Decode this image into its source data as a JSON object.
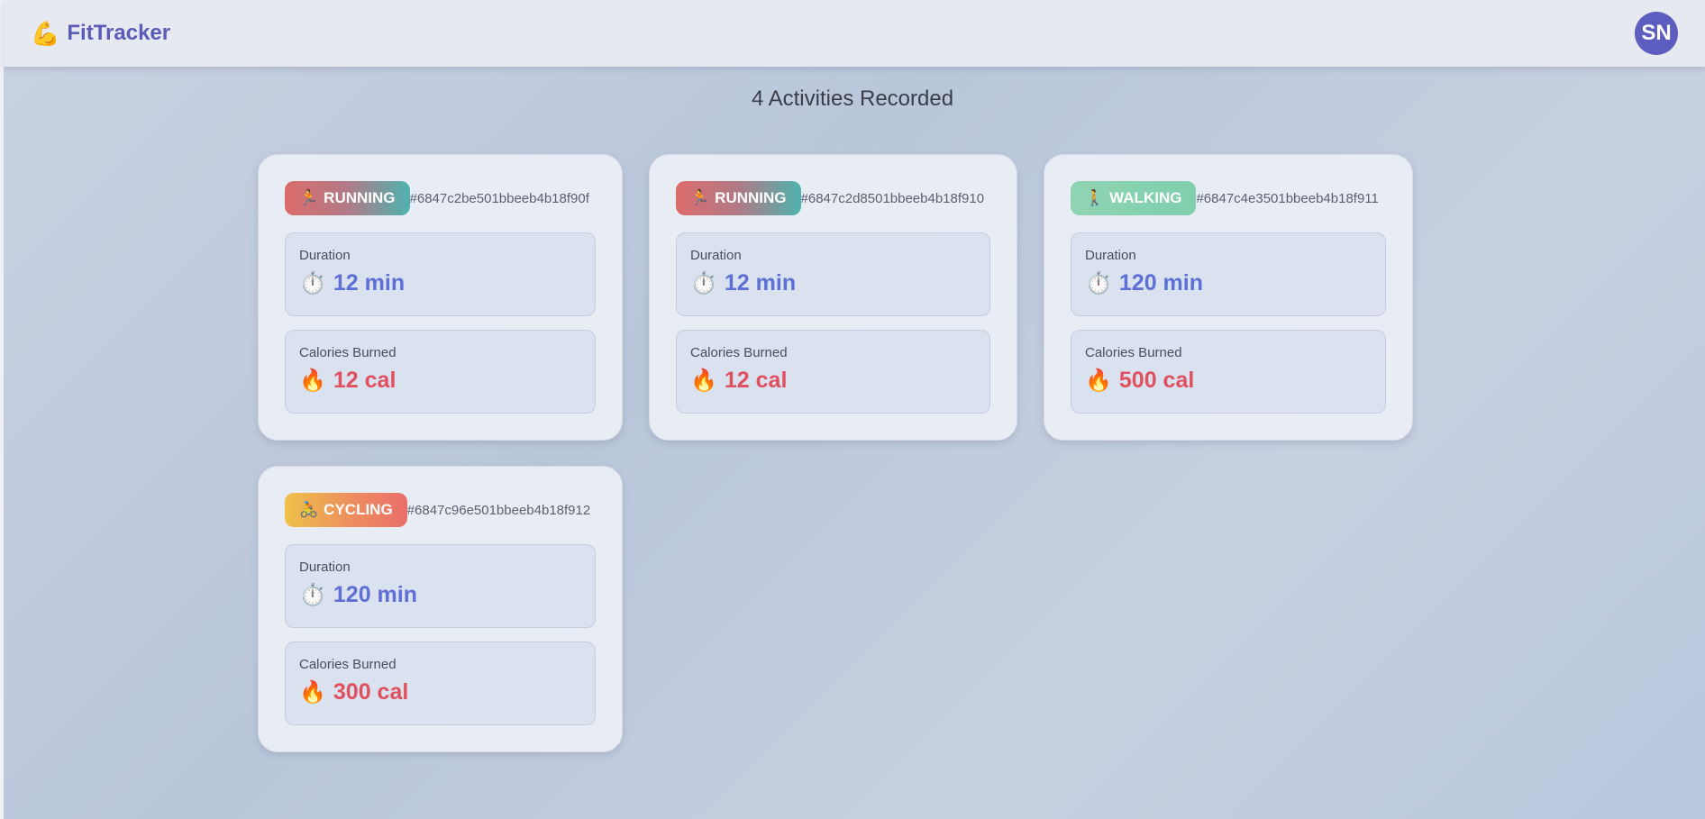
{
  "app": {
    "brand_icon": "💪",
    "brand_name": "FitTracker",
    "user_initials": "SN"
  },
  "summary": {
    "heading": "4 Activities Recorded"
  },
  "labels": {
    "duration": "Duration",
    "calories": "Calories Burned"
  },
  "icons": {
    "duration": "⏱️",
    "calories": "🔥"
  },
  "colors": {
    "brand": "#5b5bb8",
    "duration_value": "#5e6fd6",
    "calories_value": "#e0505f"
  },
  "activities": [
    {
      "type_icon": "🏃",
      "type": "RUNNING",
      "id": "#6847c2be501bbeeb4b18f90f",
      "duration": "12 min",
      "calories": "12 cal"
    },
    {
      "type_icon": "🏃",
      "type": "RUNNING",
      "id": "#6847c2d8501bbeeb4b18f910",
      "duration": "12 min",
      "calories": "12 cal"
    },
    {
      "type_icon": "🚶",
      "type": "WALKING",
      "id": "#6847c4e3501bbeeb4b18f911",
      "duration": "120 min",
      "calories": "500 cal"
    },
    {
      "type_icon": "🚴",
      "type": "CYCLING",
      "id": "#6847c96e501bbeeb4b18f912",
      "duration": "120 min",
      "calories": "300 cal"
    }
  ]
}
